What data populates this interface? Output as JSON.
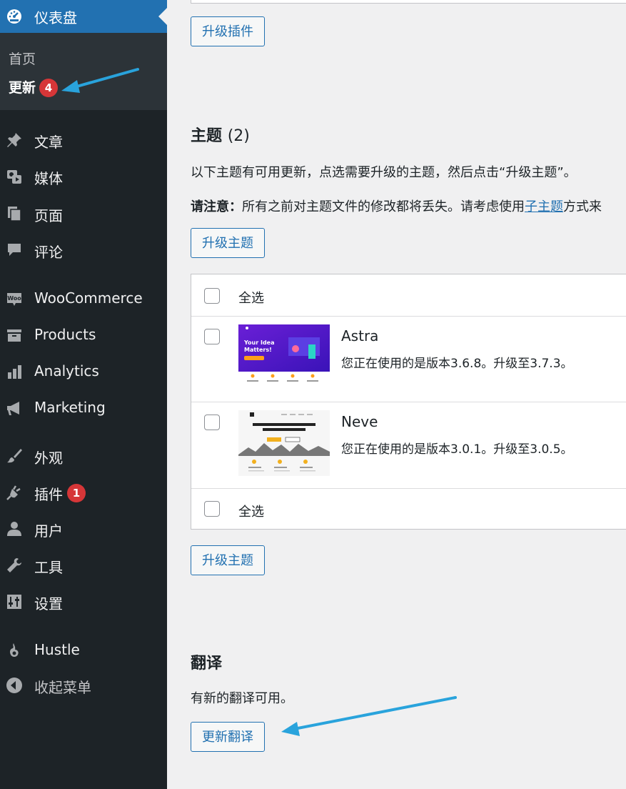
{
  "sidebar": {
    "dashboard": "仪表盘",
    "submenu": {
      "home": "首页",
      "updates": "更新",
      "updates_count": "4"
    },
    "items": [
      {
        "label": "文章",
        "icon": "pin-icon"
      },
      {
        "label": "媒体",
        "icon": "media-icon"
      },
      {
        "label": "页面",
        "icon": "pages-icon"
      },
      {
        "label": "评论",
        "icon": "comment-icon"
      },
      {
        "label": "WooCommerce",
        "icon": "woo-icon"
      },
      {
        "label": "Products",
        "icon": "archive-icon"
      },
      {
        "label": "Analytics",
        "icon": "bar-chart-icon"
      },
      {
        "label": "Marketing",
        "icon": "megaphone-icon"
      },
      {
        "label": "外观",
        "icon": "brush-icon"
      },
      {
        "label": "插件",
        "icon": "plugin-icon",
        "badge": "1"
      },
      {
        "label": "用户",
        "icon": "user-icon"
      },
      {
        "label": "工具",
        "icon": "wrench-icon"
      },
      {
        "label": "设置",
        "icon": "settings-icon"
      },
      {
        "label": "Hustle",
        "icon": "hustle-icon"
      },
      {
        "label": "收起菜单",
        "icon": "collapse-icon"
      }
    ]
  },
  "plugins": {
    "upgrade_button": "升级插件"
  },
  "themes": {
    "heading": "主题",
    "count": "(2)",
    "description": "以下主题有可用更新，点选需要升级的主题，然后点击“升级主题”。",
    "note_label": "请注意：",
    "note_text": "所有之前对主题文件的修改都将丢失。请考虑使用",
    "note_link": "子主题",
    "note_tail": "方式来",
    "upgrade_button": "升级主题",
    "select_all": "全选",
    "list": [
      {
        "name": "Astra",
        "version": "您正在使用的是版本3.6.8。升级至3.7.3。",
        "thumb_headline": "Your Idea Matters!"
      },
      {
        "name": "Neve",
        "version": "您正在使用的是版本3.0.1。升级至3.0.5。",
        "thumb_headline": "Create and grow your website fast, with Neve"
      }
    ]
  },
  "translations": {
    "heading": "翻译",
    "description": "有新的翻译可用。",
    "update_button": "更新翻译"
  },
  "colors": {
    "accent": "#2271b1",
    "sidebar": "#1d2327",
    "badge": "#d63638",
    "annotation": "#29a3dc"
  }
}
